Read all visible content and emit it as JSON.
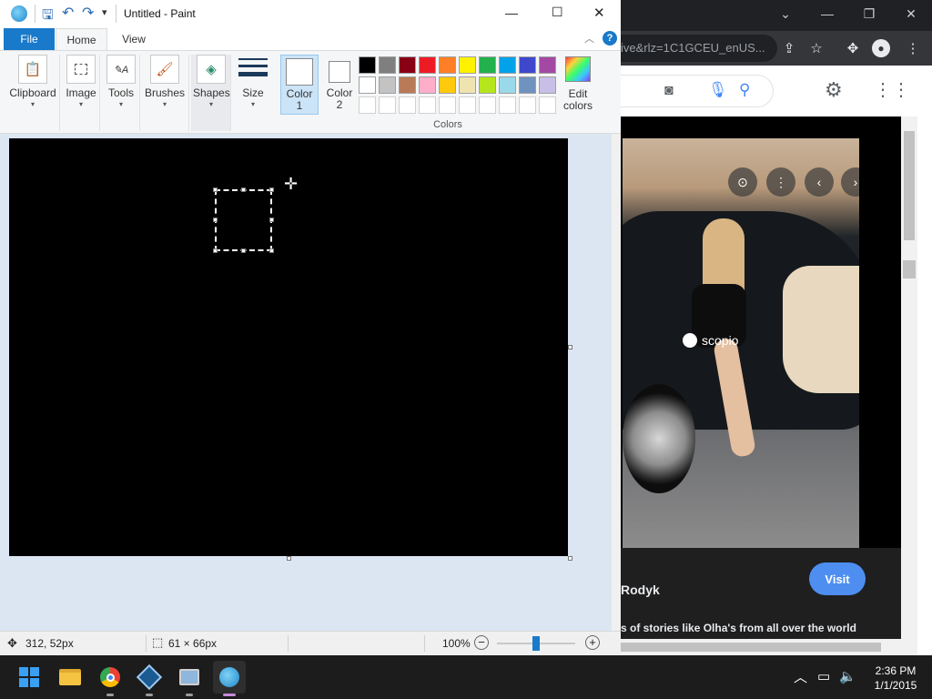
{
  "paint": {
    "title": "Untitled - Paint",
    "tabs": {
      "file": "File",
      "home": "Home",
      "view": "View"
    },
    "ribbon": {
      "clipboard": "Clipboard",
      "image": "Image",
      "tools": "Tools",
      "brushes": "Brushes",
      "shapes": "Shapes",
      "size": "Size",
      "color1_line1": "Color",
      "color1_line2": "1",
      "color2_line1": "Color",
      "color2_line2": "2",
      "edit_colors_line1": "Edit",
      "edit_colors_line2": "colors",
      "colors_group": "Colors"
    },
    "palette_row1": [
      "#000000",
      "#7f7f7f",
      "#880015",
      "#ed1c24",
      "#ff7f27",
      "#fff200",
      "#22b14c",
      "#00a2e8",
      "#3f48cc",
      "#a349a4"
    ],
    "palette_row2": [
      "#ffffff",
      "#c3c3c3",
      "#b97a57",
      "#ffaec9",
      "#ffc90e",
      "#efe4b0",
      "#b5e61d",
      "#99d9ea",
      "#7092be",
      "#c8bfe7"
    ],
    "palette_row3": [
      "#ffffff",
      "#ffffff",
      "#ffffff",
      "#ffffff",
      "#ffffff",
      "#ffffff",
      "#ffffff",
      "#ffffff",
      "#ffffff",
      "#ffffff"
    ],
    "status": {
      "cursor_pos": "312, 52px",
      "selection_size": "61 × 66px",
      "zoom": "100%",
      "zoom_fraction": 0.5
    },
    "canvas_color": "#000000"
  },
  "chrome": {
    "url_fragment": "ive&rlz=1C1GCEU_enUS...",
    "visit": "Visit",
    "author": "Rodyk",
    "tagline": "s of stories like Olha's from all over the world",
    "watermark": "scopio"
  },
  "taskbar": {
    "time": "2:36 PM",
    "date": "1/1/2015"
  }
}
